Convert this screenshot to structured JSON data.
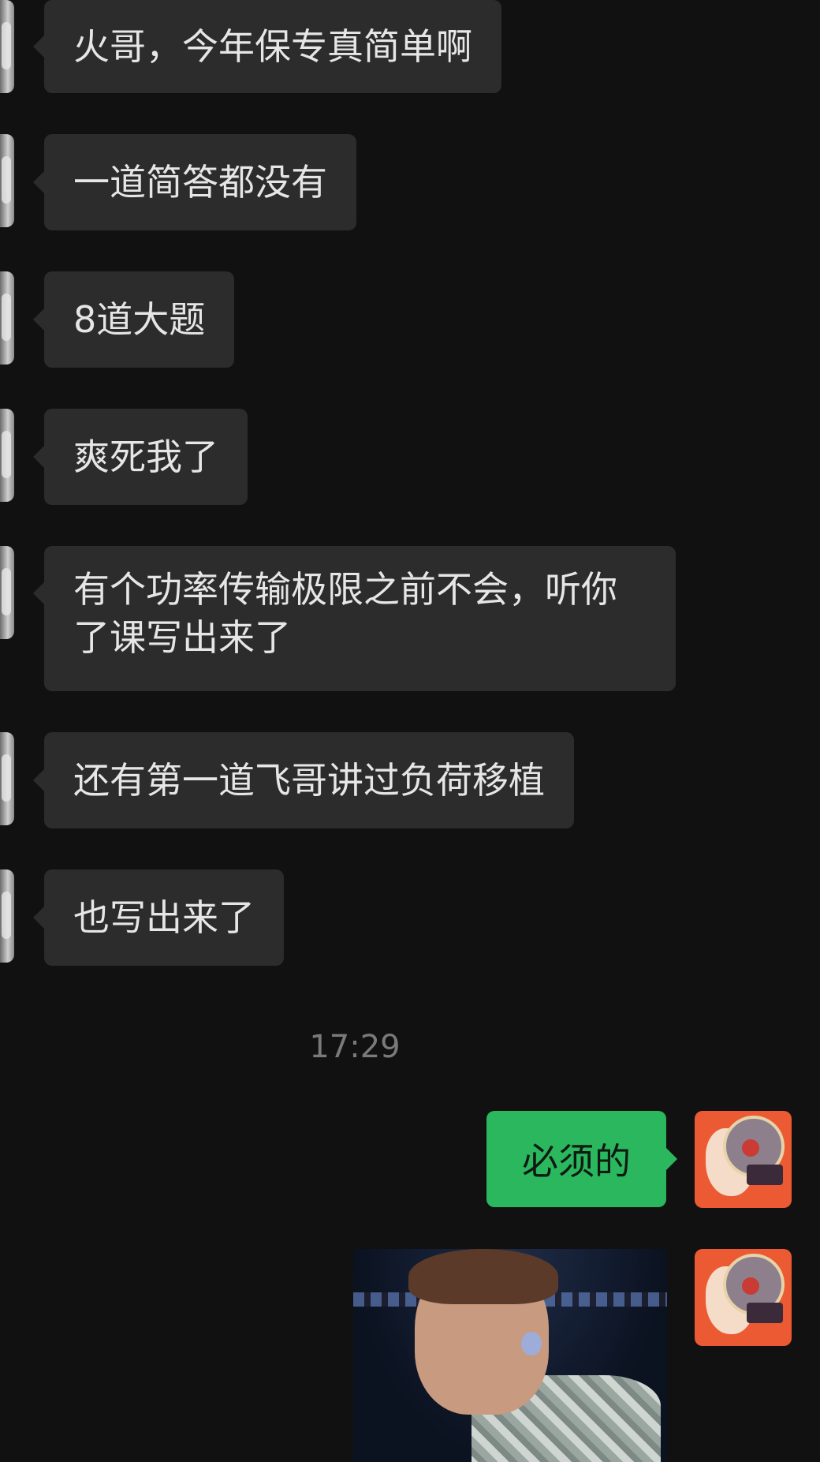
{
  "incoming_messages": [
    {
      "text": "火哥，今年保专真简单啊"
    },
    {
      "text": "一道简答都没有"
    },
    {
      "text": "8道大题"
    },
    {
      "text": "爽死我了"
    },
    {
      "text": "有个功率传输极限之前不会，听你了课写出来了"
    },
    {
      "text": "还有第一道飞哥讲过负荷移植"
    },
    {
      "text": "也写出来了"
    }
  ],
  "timestamp": "17:29",
  "outgoing_messages": [
    {
      "text": "必须的"
    },
    {
      "type": "image"
    }
  ]
}
